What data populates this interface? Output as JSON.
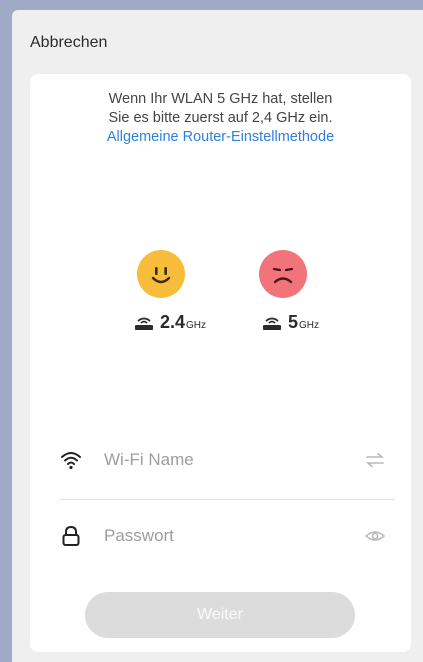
{
  "header": {
    "cancel_label": "Abbrechen"
  },
  "hint": {
    "line1": "Wenn Ihr WLAN 5 GHz hat, stellen",
    "line2": "Sie es bitte zuerst auf 2,4 GHz ein.",
    "link": "Allgemeine Router-Einstellmethode"
  },
  "bands": {
    "supported": {
      "value": "2.4",
      "unit": "GHz",
      "face": "happy",
      "color": "#f7bd3a"
    },
    "unsupported": {
      "value": "5",
      "unit": "GHz",
      "face": "sad",
      "color": "#f2747b"
    }
  },
  "form": {
    "wifi": {
      "placeholder": "Wi-Fi Name",
      "value": ""
    },
    "password": {
      "placeholder": "Passwort",
      "value": ""
    }
  },
  "actions": {
    "next_label": "Weiter"
  },
  "colors": {
    "accent_link": "#2f7fe0",
    "button_disabled": "#dcdcdc"
  }
}
